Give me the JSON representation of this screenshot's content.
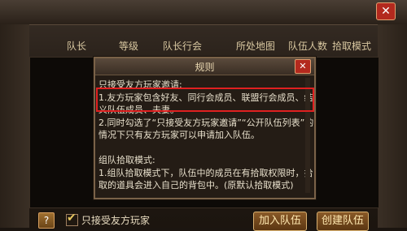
{
  "window": {
    "close_label": "✕"
  },
  "columns": [
    "队长",
    "等级",
    "队长行会",
    "所处地图",
    "队伍人数",
    "拾取模式"
  ],
  "dialog": {
    "title": "规则",
    "close_label": "✕",
    "lines": [
      "只接受友方玩家邀请:",
      "1.友方玩家包含好友、同行会成员、联盟行会成员、结",
      "义队伍成员、夫妻。",
      "2.同时勾选了“只接受友方玩家邀请”“公开队伍列表”的",
      "情况下只有友方玩家可以申请加入队伍。",
      "",
      "组队拾取模式:",
      "1.组队拾取模式下，队伍中的成员在有拾取权限时，拾",
      "取的道具会进入自己的背包中。(原默认拾取模式)"
    ]
  },
  "bottom": {
    "help_label": "?",
    "checkbox_label": "只接受友方玩家",
    "checkbox_checked": true,
    "join_button": "加入队伍",
    "create_button": "创建队伍"
  }
}
